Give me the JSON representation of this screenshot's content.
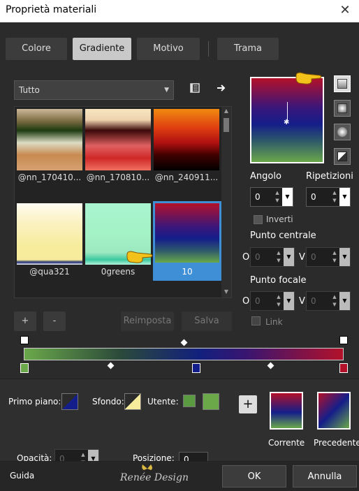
{
  "window": {
    "title": "Proprietà materiali",
    "close_glyph": "✕"
  },
  "tabs": [
    {
      "label": "Colore",
      "active": false
    },
    {
      "label": "Gradiente",
      "active": true
    },
    {
      "label": "Motivo",
      "active": false
    },
    {
      "label": "Trama",
      "active": false
    }
  ],
  "category": {
    "selected": "Tutto"
  },
  "gallery": {
    "items": [
      {
        "label": "@nn_170410...",
        "selected": false
      },
      {
        "label": "@nn_170810...",
        "selected": false
      },
      {
        "label": "@nn_240911...",
        "selected": false
      },
      {
        "label": "@qua321",
        "selected": false
      },
      {
        "label": "0greens",
        "selected": false
      },
      {
        "label": "10",
        "selected": true
      }
    ]
  },
  "gallery_actions": {
    "add": "+",
    "remove": "-",
    "reset": "Reimposta",
    "save": "Salva"
  },
  "angle": {
    "label": "Angolo",
    "value": "0"
  },
  "repeats": {
    "label": "Ripetizioni",
    "value": "0"
  },
  "invert": {
    "label": "Inverti",
    "checked": false
  },
  "center_point": {
    "label": "Punto centrale",
    "o_label": "O",
    "o_value": "0",
    "v_label": "V",
    "v_value": "0"
  },
  "focal_point": {
    "label": "Punto focale",
    "o_label": "O",
    "o_value": "0",
    "v_label": "V",
    "v_value": "0"
  },
  "link": {
    "label": "Link",
    "checked": false
  },
  "bottom": {
    "foreground_label": "Primo piano:",
    "background_label": "Sfondo:",
    "user_label": "Utente:",
    "opacity_label": "Opacità:",
    "opacity_value": "0",
    "position_label": "Posizione:",
    "position_value": "0",
    "current_label": "Corrente",
    "previous_label": "Precedente",
    "add_glyph": "+"
  },
  "footer": {
    "help": "Guida",
    "brand": "Renée Design",
    "ok": "OK",
    "cancel": "Annulla"
  },
  "colors": {
    "green": "#6aa84a",
    "navy": "#141e8a",
    "red": "#b3112a",
    "accent": "#3e8fd6"
  }
}
